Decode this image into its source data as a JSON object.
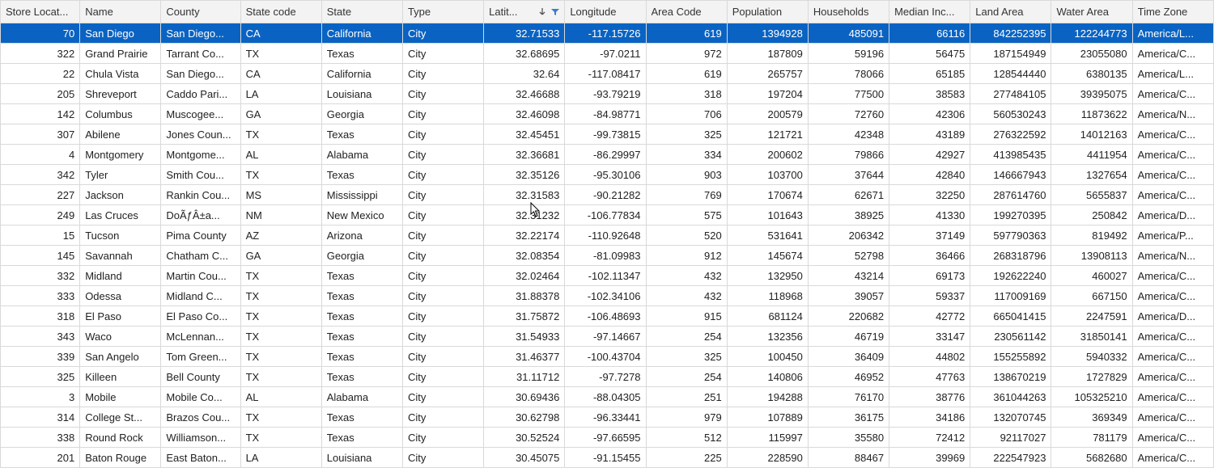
{
  "columns": [
    {
      "key": "loc",
      "label": "Store Locat...",
      "align": "right",
      "width": 98
    },
    {
      "key": "name",
      "label": "Name",
      "align": "left",
      "width": 100
    },
    {
      "key": "county",
      "label": "County",
      "align": "left",
      "width": 98
    },
    {
      "key": "stcode",
      "label": "State code",
      "align": "left",
      "width": 100
    },
    {
      "key": "state",
      "label": "State",
      "align": "left",
      "width": 100
    },
    {
      "key": "type",
      "label": "Type",
      "align": "left",
      "width": 100
    },
    {
      "key": "lat",
      "label": "Latit...",
      "align": "right",
      "width": 100,
      "sort": "desc",
      "filter": true
    },
    {
      "key": "lon",
      "label": "Longitude",
      "align": "right",
      "width": 100
    },
    {
      "key": "area",
      "label": "Area Code",
      "align": "right",
      "width": 100
    },
    {
      "key": "pop",
      "label": "Population",
      "align": "right",
      "width": 100
    },
    {
      "key": "hh",
      "label": "Households",
      "align": "right",
      "width": 100
    },
    {
      "key": "inc",
      "label": "Median Inc...",
      "align": "right",
      "width": 100
    },
    {
      "key": "land",
      "label": "Land Area",
      "align": "right",
      "width": 100
    },
    {
      "key": "water",
      "label": "Water Area",
      "align": "right",
      "width": 100
    },
    {
      "key": "tz",
      "label": "Time Zone",
      "align": "left",
      "width": 100
    }
  ],
  "rows": [
    {
      "selected": true,
      "loc": "70",
      "name": "San Diego",
      "county": "San Diego...",
      "stcode": "CA",
      "state": "California",
      "type": "City",
      "lat": "32.71533",
      "lon": "-117.15726",
      "area": "619",
      "pop": "1394928",
      "hh": "485091",
      "inc": "66116",
      "land": "842252395",
      "water": "122244773",
      "tz": "America/L..."
    },
    {
      "loc": "322",
      "name": "Grand Prairie",
      "county": "Tarrant Co...",
      "stcode": "TX",
      "state": "Texas",
      "type": "City",
      "lat": "32.68695",
      "lon": "-97.0211",
      "area": "972",
      "pop": "187809",
      "hh": "59196",
      "inc": "56475",
      "land": "187154949",
      "water": "23055080",
      "tz": "America/C..."
    },
    {
      "loc": "22",
      "name": "Chula Vista",
      "county": "San Diego...",
      "stcode": "CA",
      "state": "California",
      "type": "City",
      "lat": "32.64",
      "lon": "-117.08417",
      "area": "619",
      "pop": "265757",
      "hh": "78066",
      "inc": "65185",
      "land": "128544440",
      "water": "6380135",
      "tz": "America/L..."
    },
    {
      "loc": "205",
      "name": "Shreveport",
      "county": "Caddo Pari...",
      "stcode": "LA",
      "state": "Louisiana",
      "type": "City",
      "lat": "32.46688",
      "lon": "-93.79219",
      "area": "318",
      "pop": "197204",
      "hh": "77500",
      "inc": "38583",
      "land": "277484105",
      "water": "39395075",
      "tz": "America/C..."
    },
    {
      "loc": "142",
      "name": "Columbus",
      "county": "Muscogee...",
      "stcode": "GA",
      "state": "Georgia",
      "type": "City",
      "lat": "32.46098",
      "lon": "-84.98771",
      "area": "706",
      "pop": "200579",
      "hh": "72760",
      "inc": "42306",
      "land": "560530243",
      "water": "11873622",
      "tz": "America/N..."
    },
    {
      "loc": "307",
      "name": "Abilene",
      "county": "Jones Coun...",
      "stcode": "TX",
      "state": "Texas",
      "type": "City",
      "lat": "32.45451",
      "lon": "-99.73815",
      "area": "325",
      "pop": "121721",
      "hh": "42348",
      "inc": "43189",
      "land": "276322592",
      "water": "14012163",
      "tz": "America/C..."
    },
    {
      "loc": "4",
      "name": "Montgomery",
      "county": "Montgome...",
      "stcode": "AL",
      "state": "Alabama",
      "type": "City",
      "lat": "32.36681",
      "lon": "-86.29997",
      "area": "334",
      "pop": "200602",
      "hh": "79866",
      "inc": "42927",
      "land": "413985435",
      "water": "4411954",
      "tz": "America/C..."
    },
    {
      "loc": "342",
      "name": "Tyler",
      "county": "Smith Cou...",
      "stcode": "TX",
      "state": "Texas",
      "type": "City",
      "lat": "32.35126",
      "lon": "-95.30106",
      "area": "903",
      "pop": "103700",
      "hh": "37644",
      "inc": "42840",
      "land": "146667943",
      "water": "1327654",
      "tz": "America/C..."
    },
    {
      "loc": "227",
      "name": "Jackson",
      "county": "Rankin Cou...",
      "stcode": "MS",
      "state": "Mississippi",
      "type": "City",
      "lat": "32.31583",
      "lon": "-90.21282",
      "area": "769",
      "pop": "170674",
      "hh": "62671",
      "inc": "32250",
      "land": "287614760",
      "water": "5655837",
      "tz": "America/C..."
    },
    {
      "loc": "249",
      "name": "Las Cruces",
      "county": "DoÃƒÂ±a...",
      "stcode": "NM",
      "state": "New Mexico",
      "type": "City",
      "lat": "32.31232",
      "lon": "-106.77834",
      "area": "575",
      "pop": "101643",
      "hh": "38925",
      "inc": "41330",
      "land": "199270395",
      "water": "250842",
      "tz": "America/D..."
    },
    {
      "loc": "15",
      "name": "Tucson",
      "county": "Pima County",
      "stcode": "AZ",
      "state": "Arizona",
      "type": "City",
      "lat": "32.22174",
      "lon": "-110.92648",
      "area": "520",
      "pop": "531641",
      "hh": "206342",
      "inc": "37149",
      "land": "597790363",
      "water": "819492",
      "tz": "America/P..."
    },
    {
      "loc": "145",
      "name": "Savannah",
      "county": "Chatham C...",
      "stcode": "GA",
      "state": "Georgia",
      "type": "City",
      "lat": "32.08354",
      "lon": "-81.09983",
      "area": "912",
      "pop": "145674",
      "hh": "52798",
      "inc": "36466",
      "land": "268318796",
      "water": "13908113",
      "tz": "America/N..."
    },
    {
      "loc": "332",
      "name": "Midland",
      "county": "Martin Cou...",
      "stcode": "TX",
      "state": "Texas",
      "type": "City",
      "lat": "32.02464",
      "lon": "-102.11347",
      "area": "432",
      "pop": "132950",
      "hh": "43214",
      "inc": "69173",
      "land": "192622240",
      "water": "460027",
      "tz": "America/C..."
    },
    {
      "loc": "333",
      "name": "Odessa",
      "county": "Midland C...",
      "stcode": "TX",
      "state": "Texas",
      "type": "City",
      "lat": "31.88378",
      "lon": "-102.34106",
      "area": "432",
      "pop": "118968",
      "hh": "39057",
      "inc": "59337",
      "land": "117009169",
      "water": "667150",
      "tz": "America/C..."
    },
    {
      "loc": "318",
      "name": "El Paso",
      "county": "El Paso Co...",
      "stcode": "TX",
      "state": "Texas",
      "type": "City",
      "lat": "31.75872",
      "lon": "-106.48693",
      "area": "915",
      "pop": "681124",
      "hh": "220682",
      "inc": "42772",
      "land": "665041415",
      "water": "2247591",
      "tz": "America/D..."
    },
    {
      "loc": "343",
      "name": "Waco",
      "county": "McLennan...",
      "stcode": "TX",
      "state": "Texas",
      "type": "City",
      "lat": "31.54933",
      "lon": "-97.14667",
      "area": "254",
      "pop": "132356",
      "hh": "46719",
      "inc": "33147",
      "land": "230561142",
      "water": "31850141",
      "tz": "America/C..."
    },
    {
      "loc": "339",
      "name": "San Angelo",
      "county": "Tom Green...",
      "stcode": "TX",
      "state": "Texas",
      "type": "City",
      "lat": "31.46377",
      "lon": "-100.43704",
      "area": "325",
      "pop": "100450",
      "hh": "36409",
      "inc": "44802",
      "land": "155255892",
      "water": "5940332",
      "tz": "America/C..."
    },
    {
      "loc": "325",
      "name": "Killeen",
      "county": "Bell County",
      "stcode": "TX",
      "state": "Texas",
      "type": "City",
      "lat": "31.11712",
      "lon": "-97.7278",
      "area": "254",
      "pop": "140806",
      "hh": "46952",
      "inc": "47763",
      "land": "138670219",
      "water": "1727829",
      "tz": "America/C..."
    },
    {
      "loc": "3",
      "name": "Mobile",
      "county": "Mobile Co...",
      "stcode": "AL",
      "state": "Alabama",
      "type": "City",
      "lat": "30.69436",
      "lon": "-88.04305",
      "area": "251",
      "pop": "194288",
      "hh": "76170",
      "inc": "38776",
      "land": "361044263",
      "water": "105325210",
      "tz": "America/C..."
    },
    {
      "loc": "314",
      "name": "College St...",
      "county": "Brazos Cou...",
      "stcode": "TX",
      "state": "Texas",
      "type": "City",
      "lat": "30.62798",
      "lon": "-96.33441",
      "area": "979",
      "pop": "107889",
      "hh": "36175",
      "inc": "34186",
      "land": "132070745",
      "water": "369349",
      "tz": "America/C..."
    },
    {
      "loc": "338",
      "name": "Round Rock",
      "county": "Williamson...",
      "stcode": "TX",
      "state": "Texas",
      "type": "City",
      "lat": "30.52524",
      "lon": "-97.66595",
      "area": "512",
      "pop": "115997",
      "hh": "35580",
      "inc": "72412",
      "land": "92117027",
      "water": "781179",
      "tz": "America/C..."
    },
    {
      "loc": "201",
      "name": "Baton Rouge",
      "county": "East Baton...",
      "stcode": "LA",
      "state": "Louisiana",
      "type": "City",
      "lat": "30.45075",
      "lon": "-91.15455",
      "area": "225",
      "pop": "228590",
      "hh": "88467",
      "inc": "39969",
      "land": "222547923",
      "water": "5682680",
      "tz": "America/C..."
    }
  ]
}
